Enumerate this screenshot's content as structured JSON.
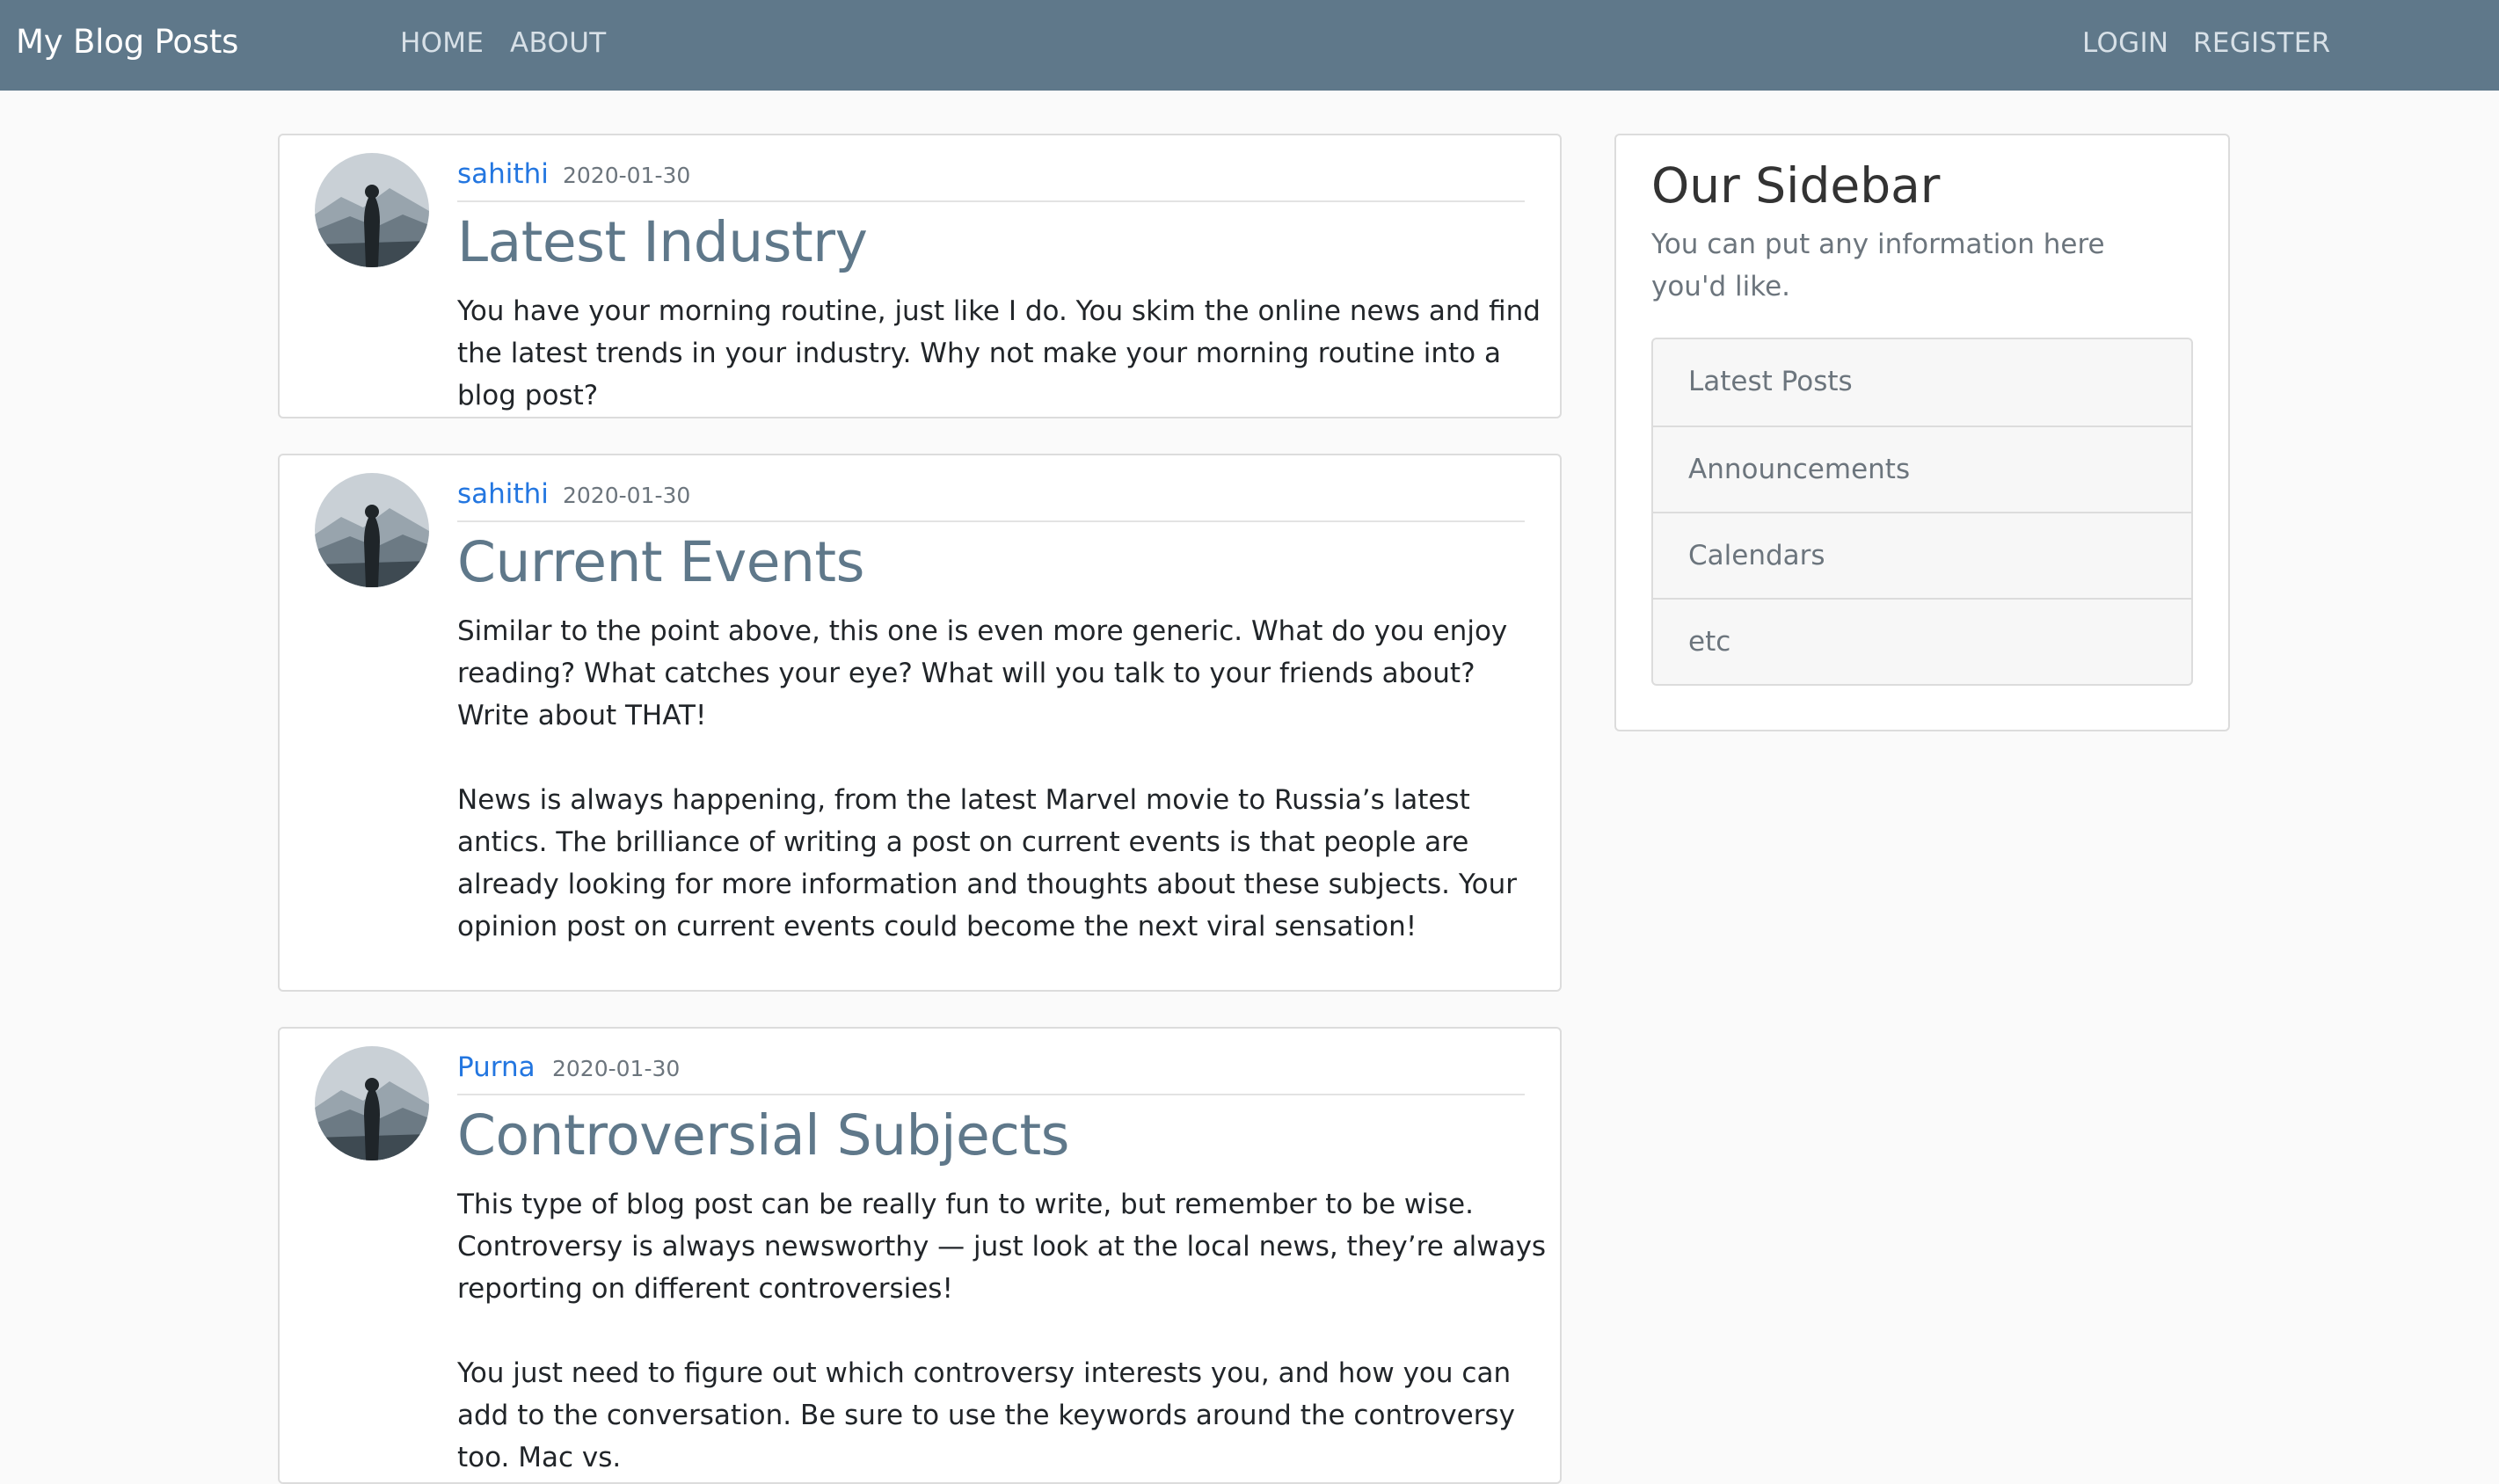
{
  "navbar": {
    "brand": "My Blog Posts",
    "links": {
      "home": "HOME",
      "about": "ABOUT",
      "login": "LOGIN",
      "register": "REGISTER"
    }
  },
  "posts": [
    {
      "author": "sahithi",
      "date": "2020-01-30",
      "title": "Latest Industry",
      "paragraphs": [
        "You have your morning routine, just like I do. You skim the online news and find the latest trends in your industry. Why not make your morning routine into a blog post?"
      ]
    },
    {
      "author": "sahithi",
      "date": "2020-01-30",
      "title": "Current Events",
      "paragraphs": [
        "Similar to the point above, this one is even more generic. What do you enjoy reading? What catches your eye? What will you talk to your friends about? Write about THAT!",
        "News is always happening, from the latest Marvel movie to Russia’s latest antics. The brilliance of writing a post on current events is that people are already looking for more information and thoughts about these subjects. Your opinion post on current events could become the next viral sensation!"
      ]
    },
    {
      "author": "Purna",
      "date": "2020-01-30",
      "title": "Controversial Subjects",
      "paragraphs": [
        "This type of blog post can be really fun to write, but remember to be wise. Controversy is always newsworthy — just look at the local news, they’re always reporting on different controversies!",
        "You just need to figure out which controversy interests you, and how you can add to the conversation. Be sure to use the keywords around the controversy too. Mac vs."
      ]
    }
  ],
  "sidebar": {
    "title": "Our Sidebar",
    "description": "You can put any information here you'd like.",
    "items": [
      "Latest Posts",
      "Announcements",
      "Calendars",
      "etc"
    ]
  },
  "colors": {
    "navbar_bg": "#5f788a",
    "link_blue": "#2376e0",
    "title_slate": "#5f788a",
    "page_bg": "#fafafa"
  },
  "icons": {
    "avatar": "user-avatar-mountain-silhouette"
  }
}
